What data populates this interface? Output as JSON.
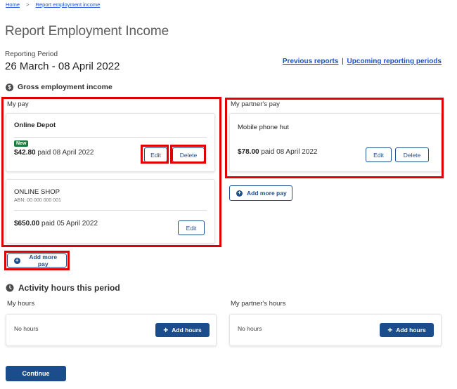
{
  "breadcrumb": {
    "home": "Home",
    "separator": ">",
    "current": "Report employment income"
  },
  "page": {
    "title": "Report Employment Income"
  },
  "period": {
    "label": "Reporting Period",
    "value": "26 March - 08 April 2022"
  },
  "links": {
    "previous": "Previous reports",
    "divider": "|",
    "upcoming": "Upcoming reporting periods"
  },
  "gross": {
    "icon_glyph": "$",
    "heading": "Gross employment income",
    "my_pay": {
      "label": "My pay",
      "employers": [
        {
          "name": "Online Depot",
          "abn": "",
          "badge": "New",
          "amount": "$42.80",
          "paid_text": "paid",
          "date": "08 April 2022",
          "edit": "Edit",
          "delete": "Delete"
        },
        {
          "name": "ONLINE SHOP",
          "abn": "ABN: 00 000 000 001",
          "badge": "",
          "amount": "$650.00",
          "paid_text": "paid",
          "date": "05 April 2022",
          "edit": "Edit",
          "delete": ""
        }
      ],
      "add_more": "Add more pay"
    },
    "partner_pay": {
      "label": "My partner's pay",
      "employers": [
        {
          "name": "Mobile phone hut",
          "amount": "$78.00",
          "paid_text": "paid",
          "date": "08 April 2022",
          "edit": "Edit",
          "delete": "Delete"
        }
      ],
      "add_more": "Add more pay"
    }
  },
  "activity": {
    "icon_glyph": "clock-icon",
    "heading": "Activity hours this period",
    "my_hours": {
      "label": "My hours",
      "empty": "No hours",
      "add": "Add hours"
    },
    "partner_hours": {
      "label": "My partner's hours",
      "empty": "No hours",
      "add": "Add hours"
    }
  },
  "footer": {
    "continue": "Continue"
  },
  "colors": {
    "primary": "#1b4c8c",
    "link": "#1a4ed8",
    "highlight": "#e00000",
    "badge": "#1c7c3c"
  }
}
